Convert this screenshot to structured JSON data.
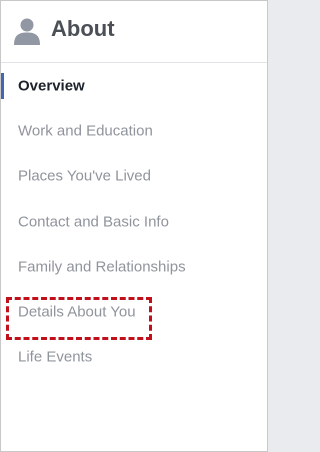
{
  "header": {
    "title": "About",
    "icon": "person-silhouette-icon"
  },
  "nav": {
    "items": [
      {
        "label": "Overview",
        "active": true
      },
      {
        "label": "Work and Education",
        "active": false
      },
      {
        "label": "Places You've Lived",
        "active": false
      },
      {
        "label": "Contact and Basic Info",
        "active": false
      },
      {
        "label": "Family and Relationships",
        "active": false
      },
      {
        "label": "Details About You",
        "active": false,
        "highlighted": true
      },
      {
        "label": "Life Events",
        "active": false
      }
    ]
  },
  "colors": {
    "active_indicator": "#4267b2",
    "highlight_border": "#c0101b",
    "inactive_text": "#90949c",
    "active_text": "#1d2129"
  }
}
